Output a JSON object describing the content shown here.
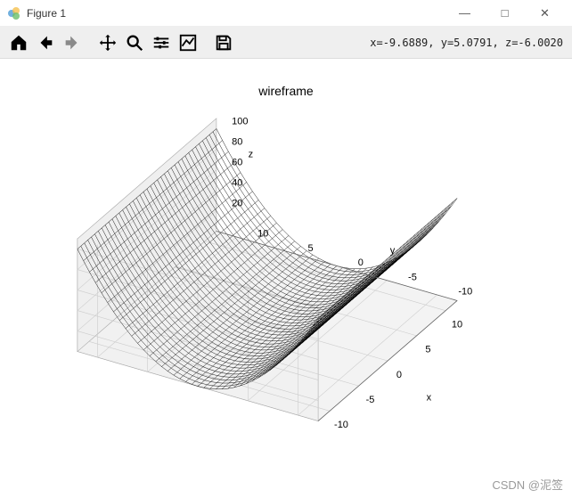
{
  "window": {
    "title": "Figure 1",
    "minimize": "—",
    "maximize": "□",
    "close": "✕"
  },
  "toolbar": {
    "coords_text": "x=-9.6889, y=5.0791, z=-6.0020"
  },
  "chart_data": {
    "type": "wireframe3d",
    "title": "wireframe",
    "x_range": [
      -12,
      12
    ],
    "y_range": [
      -12,
      12
    ],
    "z_range": [
      0,
      110
    ],
    "x_ticks": [
      -10,
      -5,
      0,
      5,
      10
    ],
    "y_ticks": [
      -10,
      -5,
      0,
      5,
      10
    ],
    "z_ticks": [
      20,
      40,
      60,
      80,
      100
    ],
    "xlabel": "x",
    "ylabel": "y",
    "zlabel": "z",
    "function": "z = x^2 * 0 + y^2 (parabolic cylinder along x)",
    "series": [
      {
        "x": -10,
        "y": -10,
        "z": 100
      },
      {
        "x": -10,
        "y": 0,
        "z": 0
      },
      {
        "x": -10,
        "y": 10,
        "z": 100
      },
      {
        "x": 0,
        "y": -10,
        "z": 100
      },
      {
        "x": 0,
        "y": 0,
        "z": 0
      },
      {
        "x": 0,
        "y": 10,
        "z": 100
      },
      {
        "x": 10,
        "y": -10,
        "z": 100
      },
      {
        "x": 10,
        "y": 0,
        "z": 0
      },
      {
        "x": 10,
        "y": 10,
        "z": 100
      }
    ],
    "elev": 30,
    "azim": -60
  },
  "watermark": "CSDN @泥签"
}
